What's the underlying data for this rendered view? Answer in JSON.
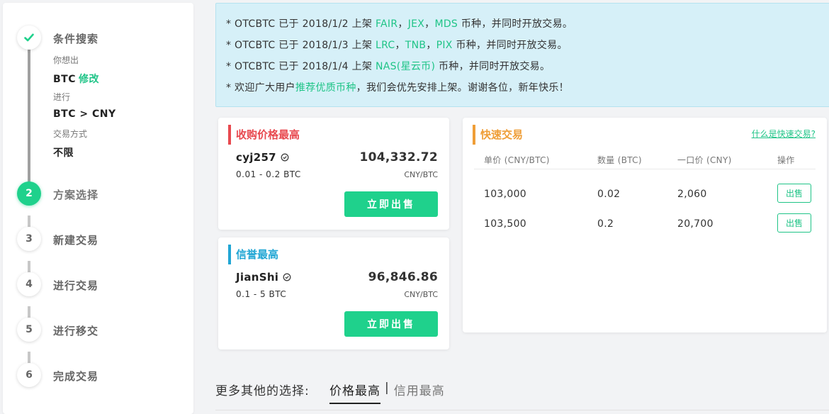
{
  "steps": [
    {
      "num": "",
      "title": "条件搜索",
      "state": "done"
    },
    {
      "num": "2",
      "title": "方案选择",
      "state": "active"
    },
    {
      "num": "3",
      "title": "新建交易",
      "state": "pending"
    },
    {
      "num": "4",
      "title": "进行交易",
      "state": "pending"
    },
    {
      "num": "5",
      "title": "进行移交",
      "state": "pending"
    },
    {
      "num": "6",
      "title": "完成交易",
      "state": "pending"
    }
  ],
  "condition": {
    "want_label": "你想出",
    "want_value": "BTC",
    "edit_label": "修改",
    "pair_label": "进行",
    "pair_value": "BTC > CNY",
    "method_label": "交易方式",
    "method_value": "不限"
  },
  "notice": {
    "lines": [
      {
        "prefix": "* OTCBTC 已于 2018/1/2 上架 ",
        "coins": [
          "FAIR",
          "JEX",
          "MDS"
        ],
        "suffix": " 币种，并同时开放交易。"
      },
      {
        "prefix": "* OTCBTC 已于 2018/1/3 上架 ",
        "coins": [
          "LRC",
          "TNB",
          "PIX"
        ],
        "suffix": " 币种，并同时开放交易。"
      },
      {
        "prefix": "* OTCBTC 已于 2018/1/4 上架 ",
        "coins": [
          "NAS(星云币)"
        ],
        "suffix": " 币种，并同时开放交易。"
      }
    ],
    "welcome_prefix": "* 欢迎广大用户",
    "welcome_link": "推荐优质币种",
    "welcome_suffix": "，我们会优先安排上架。谢谢各位，新年快乐！"
  },
  "best_price": {
    "title": "收购价格最高",
    "trader": "cyj257",
    "limit": "0.01 - 0.2 BTC",
    "price": "104,332.72",
    "unit": "CNY/BTC",
    "button": "立即出售"
  },
  "best_credit": {
    "title": "信誉最高",
    "trader": "JianShi",
    "limit": "0.1 - 5 BTC",
    "price": "96,846.86",
    "unit": "CNY/BTC",
    "button": "立即出售"
  },
  "quick_trade": {
    "title": "快速交易",
    "help_link": "什么是快速交易?",
    "headers": [
      "单价 (CNY/BTC)",
      "数量 (BTC)",
      "一口价 (CNY)",
      "操作"
    ],
    "rows": [
      {
        "price": "103,000",
        "qty": "0.02",
        "total": "2,060",
        "action": "出售"
      },
      {
        "price": "103,500",
        "qty": "0.2",
        "total": "20,700",
        "action": "出售"
      }
    ]
  },
  "more": {
    "label": "更多其他的选择:",
    "tab_active": "价格最高",
    "separator": "|",
    "tab_other": "信用最高"
  },
  "colors": {
    "accent_green": "#1fd18c",
    "title_red": "#e8494f",
    "title_cyan": "#21a6d4",
    "title_orange": "#ef9e37",
    "notice_bg": "#d6f0f8"
  }
}
